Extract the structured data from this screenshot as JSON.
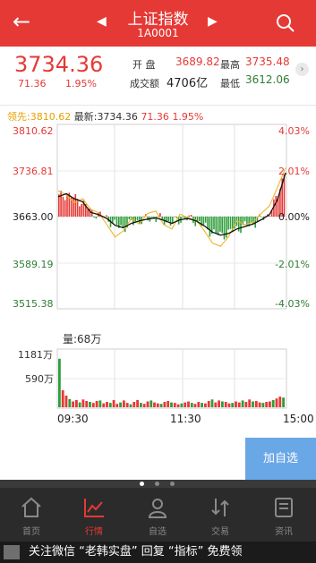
{
  "header": {
    "title": "上证指数",
    "code": "1A0001"
  },
  "quote": {
    "price": "3734.36",
    "change": "71.36",
    "change_pct": "1.95%",
    "open_label": "开 盘",
    "open": "3689.82",
    "high_label": "最高",
    "high": "3735.48",
    "volume_label": "成交额",
    "volume": "4706亿",
    "low_label": "最低",
    "low": "3612.06"
  },
  "legend": {
    "lead_label": "领先:",
    "lead": "3810.62",
    "latest_label": "最新:",
    "latest": "3734.36",
    "change": "71.36",
    "change_pct": "1.95%"
  },
  "chart_data": [
    {
      "type": "line",
      "title": "",
      "price_ticks_left": [
        "3810.62",
        "3736.81",
        "3663.00",
        "3589.19",
        "3515.38"
      ],
      "pct_ticks_right": [
        "4.03%",
        "2.01%",
        "0.00%",
        "-2.01%",
        "-4.03%"
      ],
      "ylim": [
        3515.38,
        3810.62
      ],
      "x_ticks": [
        "09:30",
        "11:30",
        "15:00"
      ],
      "series": [
        {
          "values": [
            3705,
            3698,
            3685,
            3692,
            3675,
            3669,
            3650,
            3630,
            3640,
            3660,
            3651,
            3668,
            3672,
            3650,
            3643,
            3667,
            3661,
            3657,
            3640,
            3620,
            3615,
            3631,
            3656,
            3650,
            3654,
            3668,
            3680,
            3710,
            3742
          ]
        },
        {
          "values": [
            3695,
            3700,
            3692,
            3687,
            3670,
            3666,
            3660,
            3649,
            3645,
            3652,
            3656,
            3659,
            3661,
            3657,
            3652,
            3658,
            3660,
            3656,
            3648,
            3638,
            3633,
            3636,
            3643,
            3647,
            3651,
            3658,
            3666,
            3690,
            3734
          ]
        }
      ]
    },
    {
      "type": "bar",
      "title": "量:68万",
      "y_ticks": [
        "1181万",
        "590万"
      ],
      "ylim": [
        0,
        1181
      ],
      "x_ticks": [
        "09:30",
        "11:30",
        "15:00"
      ],
      "values": [
        1000,
        350,
        240,
        170,
        120,
        150,
        100,
        160,
        130,
        110,
        90,
        130,
        140,
        80,
        110,
        90,
        150,
        70,
        100,
        140,
        90,
        60,
        110,
        150,
        90,
        70,
        120,
        140,
        100,
        80,
        70,
        110,
        130,
        100,
        90,
        60,
        80,
        100,
        120,
        90,
        70,
        110,
        90,
        80,
        130,
        160,
        100,
        140,
        120,
        110,
        80,
        90,
        120,
        100,
        140,
        110,
        160,
        120,
        130,
        100,
        90,
        110,
        120,
        150,
        180,
        220,
        200
      ]
    }
  ],
  "add_button": "加自选",
  "tabs": [
    {
      "label": "首页",
      "icon": "home-icon"
    },
    {
      "label": "行情",
      "icon": "chart-line-icon"
    },
    {
      "label": "自选",
      "icon": "user-icon"
    },
    {
      "label": "交易",
      "icon": "trade-arrows-icon"
    },
    {
      "label": "资讯",
      "icon": "news-icon"
    }
  ],
  "banner": "关注微信 “老韩实盘” 回复 “指标” 免费领"
}
